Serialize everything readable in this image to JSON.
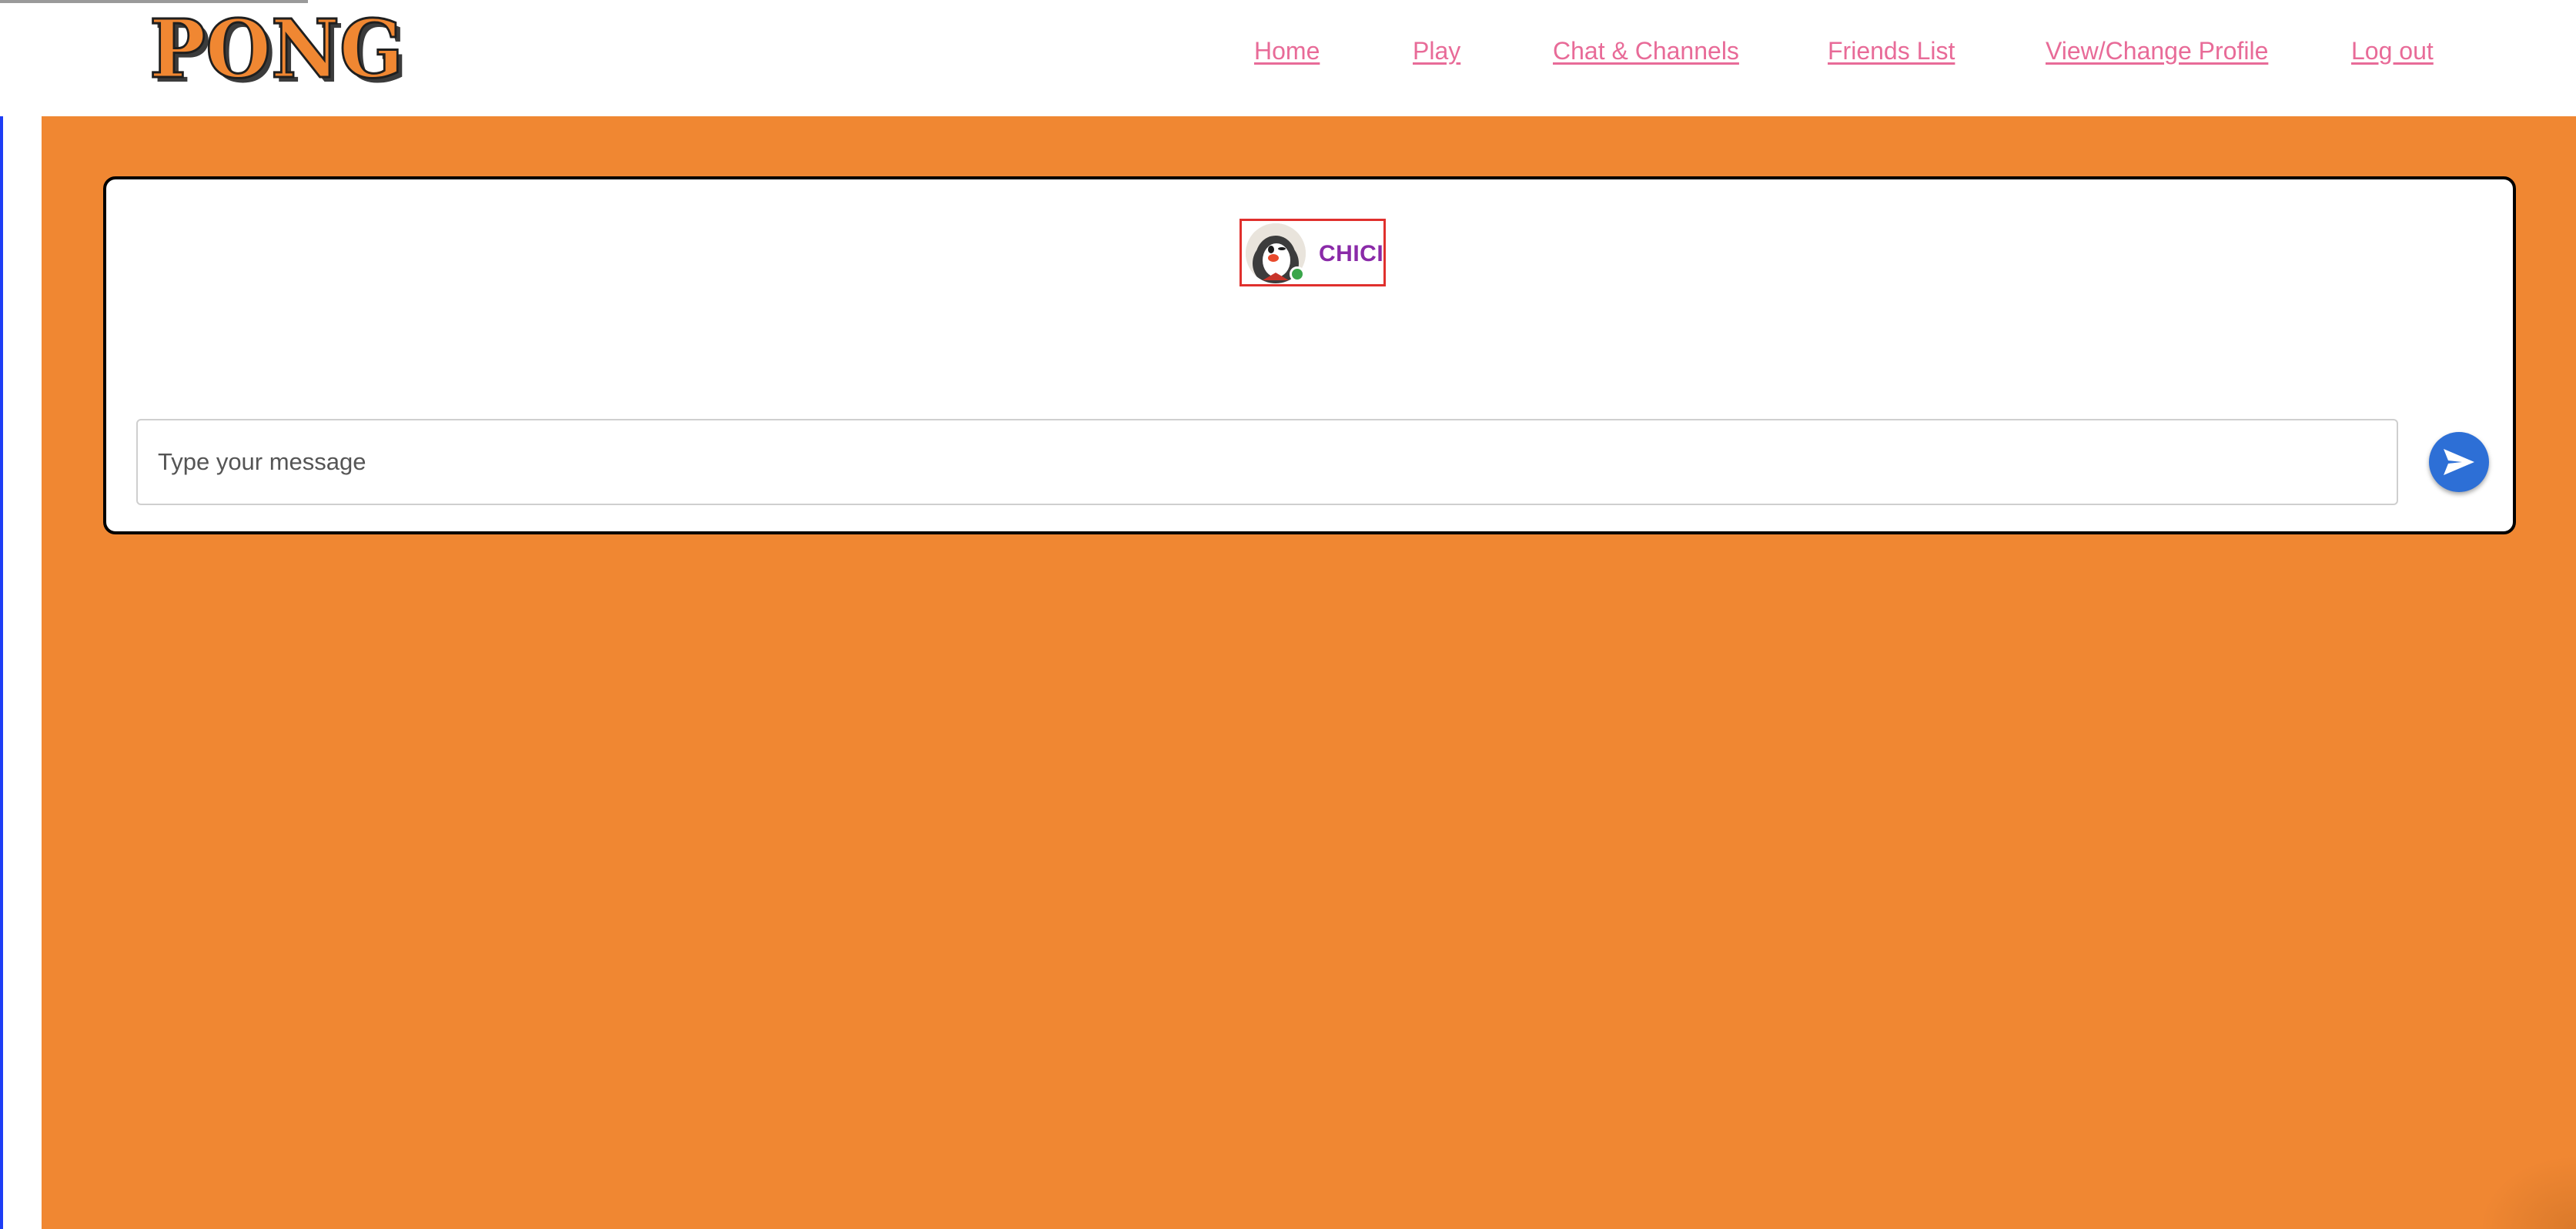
{
  "app": {
    "logo_text": "PONG"
  },
  "nav": {
    "items": [
      {
        "label": "Home"
      },
      {
        "label": "Play"
      },
      {
        "label": "Chat & Channels"
      },
      {
        "label": "Friends List"
      },
      {
        "label": "View/Change Profile"
      },
      {
        "label": "Log out"
      }
    ]
  },
  "chat": {
    "user": {
      "name": "CHICI",
      "status": "online",
      "avatar_icon": "penguin-avatar-icon"
    },
    "input": {
      "value": "",
      "placeholder": "Type your message"
    },
    "send_icon": "send-icon"
  },
  "colors": {
    "accent_background": "#f08732",
    "nav_link": "#e86b98",
    "username": "#8a2aa8",
    "send_button": "#2d6fd6",
    "online_status": "#3aa64a",
    "selection_border": "#e0302d"
  }
}
